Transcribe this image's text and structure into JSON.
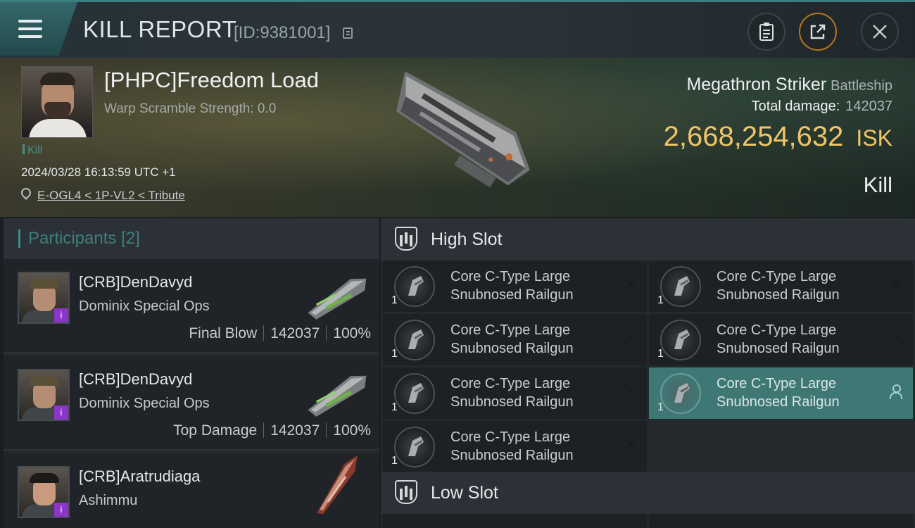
{
  "header": {
    "title": "KILL REPORT",
    "report_id": "[ID:9381001]"
  },
  "victim": {
    "name": "[PHPC]Freedom Load",
    "warp_scramble": "Warp Scramble Strength: 0.0",
    "tag": "Kill",
    "timestamp": "2024/03/28 16:13:59 UTC +1",
    "location": "E-OGL4 < 1P-VL2 < Tribute",
    "ship_name": "Megathron Striker",
    "ship_class": "Battleship",
    "total_damage_label": "Total damage:",
    "total_damage": "142037",
    "isk_value": "2,668,254,632",
    "isk_unit": "ISK",
    "result": "Kill"
  },
  "participants": {
    "heading": "Participants",
    "count": "[2]",
    "rows": [
      {
        "name": "[CRB]DenDavyd",
        "ship": "Dominix Special Ops",
        "role": "Final Blow",
        "damage": "142037",
        "percent": "100%",
        "badge": "i"
      },
      {
        "name": "[CRB]DenDavyd",
        "ship": "Dominix Special Ops",
        "role": "Top Damage",
        "damage": "142037",
        "percent": "100%",
        "badge": "i"
      },
      {
        "name": "[CRB]Aratrudiaga",
        "ship": "Ashimmu",
        "role": "",
        "damage": "",
        "percent": "",
        "badge": "i"
      }
    ]
  },
  "slots": {
    "high_label": "High Slot",
    "low_label": "Low Slot",
    "high_modules": [
      {
        "name": "Core C-Type Large Snubnosed Railgun",
        "qty": "1"
      },
      {
        "name": "Core C-Type Large Snubnosed Railgun",
        "qty": "1"
      },
      {
        "name": "Core C-Type Large Snubnosed Railgun",
        "qty": "1"
      },
      {
        "name": "Core C-Type Large Snubnosed Railgun",
        "qty": "1"
      },
      {
        "name": "Core C-Type Large Snubnosed Railgun",
        "qty": "1"
      },
      {
        "name": "Core C-Type Large Snubnosed Railgun",
        "qty": "1"
      },
      {
        "name": "Core C-Type Large Snubnosed Railgun",
        "qty": "1"
      }
    ]
  },
  "colors": {
    "accent": "#3c8e8c",
    "isk": "#f1c467",
    "badge": "#8c35c9",
    "active_module": "#3f7775"
  }
}
